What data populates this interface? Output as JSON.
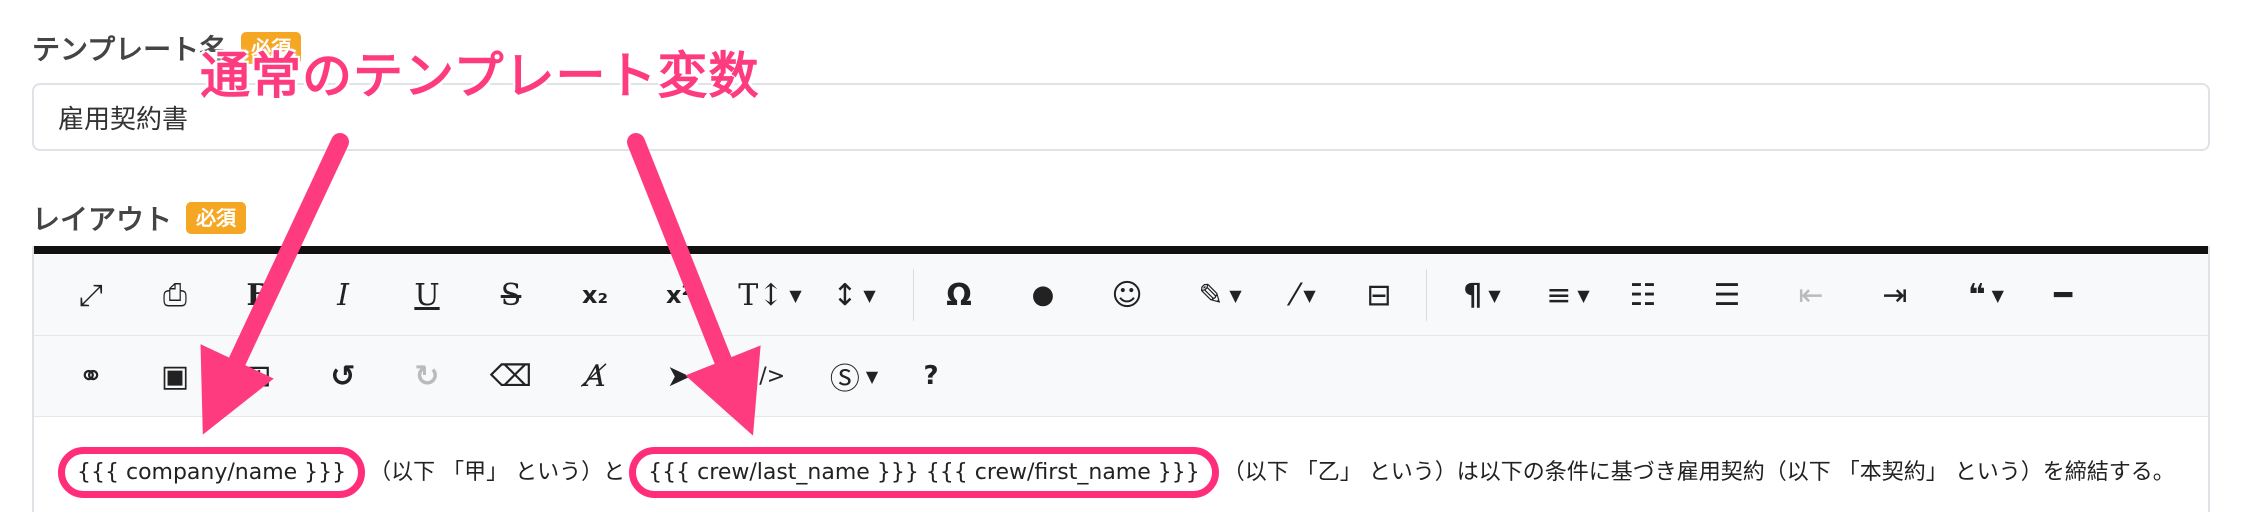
{
  "template_name": {
    "label": "テンプレート名",
    "badge": "必須",
    "value": "雇用契約書"
  },
  "layout": {
    "label": "レイアウト",
    "badge": "必須"
  },
  "annotation": {
    "text": "通常のテンプレート変数",
    "color": "#ff3b7f"
  },
  "toolbar_row1": [
    {
      "name": "fullscreen-icon",
      "glyph": "⤢"
    },
    {
      "name": "print-icon",
      "glyph": "🖶"
    },
    {
      "name": "bold-icon",
      "glyph": "B"
    },
    {
      "name": "italic-icon",
      "glyph": "I"
    },
    {
      "name": "underline-icon",
      "glyph": "U"
    },
    {
      "name": "strikethrough-icon",
      "glyph": "S"
    },
    {
      "name": "subscript-icon",
      "glyph": "x₂"
    },
    {
      "name": "superscript-icon",
      "glyph": "x²"
    },
    {
      "name": "font-size-icon",
      "glyph": "T↕"
    },
    {
      "name": "line-height-icon",
      "glyph": "↕"
    },
    {
      "name": "special-char-icon",
      "glyph": "Ω"
    },
    {
      "name": "color-drop-icon",
      "glyph": "💧"
    },
    {
      "name": "emoji-icon",
      "glyph": "☺"
    },
    {
      "name": "paint-brush-icon",
      "glyph": "🖌"
    },
    {
      "name": "magic-wand-icon",
      "glyph": "⚚"
    },
    {
      "name": "page-break-icon",
      "glyph": "⊟"
    },
    {
      "name": "paragraph-icon",
      "glyph": "¶"
    },
    {
      "name": "align-icon",
      "glyph": "≡"
    },
    {
      "name": "ordered-list-icon",
      "glyph": "⒈"
    },
    {
      "name": "unordered-list-icon",
      "glyph": "☰"
    },
    {
      "name": "outdent-icon",
      "glyph": "⇤"
    },
    {
      "name": "indent-icon",
      "glyph": "⇥"
    },
    {
      "name": "quote-icon",
      "glyph": "❝"
    },
    {
      "name": "horizontal-rule-icon",
      "glyph": "━"
    }
  ],
  "toolbar_row2": [
    {
      "name": "link-icon",
      "glyph": "🔗"
    },
    {
      "name": "image-icon",
      "glyph": "🖼"
    },
    {
      "name": "table-icon",
      "glyph": "⊞"
    },
    {
      "name": "undo-icon",
      "glyph": "↺"
    },
    {
      "name": "redo-icon",
      "glyph": "↻"
    },
    {
      "name": "eraser-icon",
      "glyph": "⌫"
    },
    {
      "name": "clear-format-icon",
      "glyph": "A̸"
    },
    {
      "name": "select-pointer-icon",
      "glyph": "➤"
    },
    {
      "name": "code-view-icon",
      "glyph": "</>"
    },
    {
      "name": "dollar-icon",
      "glyph": "Ⓢ"
    },
    {
      "name": "help-icon",
      "glyph": "?"
    }
  ],
  "content": {
    "var_company": "{{{ company/name }}}",
    "text_a": "（以下 「甲」 という）と",
    "var_crew": "{{{ crew/last_name }}} {{{ crew/first_name }}}",
    "text_b": "（以下 「乙」 という）は以下の条件に基づき雇用契約（以下 「本契約」 という）を締結する。"
  }
}
